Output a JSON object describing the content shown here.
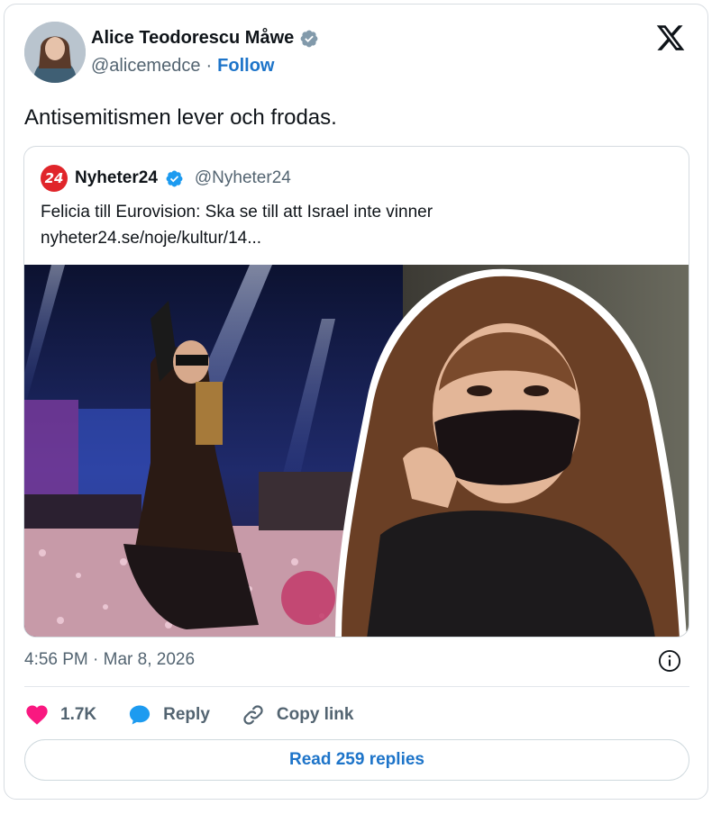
{
  "author": {
    "display_name": "Alice Teodorescu Måwe",
    "handle": "@alicemedce",
    "separator": "·",
    "follow_label": "Follow"
  },
  "tweet": {
    "text": "Antisemitismen lever och frodas.",
    "timestamp": "4:56 PM · Mar 8, 2026"
  },
  "quote": {
    "logo_text": "24",
    "name": "Nyheter24",
    "handle": "@Nyheter24",
    "headline": "Felicia till Eurovision: Ska se till att Israel inte vinner",
    "link": "nyheter24.se/noje/kultur/14..."
  },
  "actions": {
    "like_count": "1.7K",
    "reply_label": "Reply",
    "copy_link_label": "Copy link",
    "read_replies_label": "Read 259 replies"
  },
  "colors": {
    "accent": "#1d74c9",
    "verified": "#1d9bf0",
    "like": "#f91880",
    "muted": "#536471"
  },
  "icons": [
    "verified-badge-icon",
    "x-logo-icon",
    "info-icon",
    "heart-icon",
    "reply-bubble-icon",
    "link-icon"
  ]
}
